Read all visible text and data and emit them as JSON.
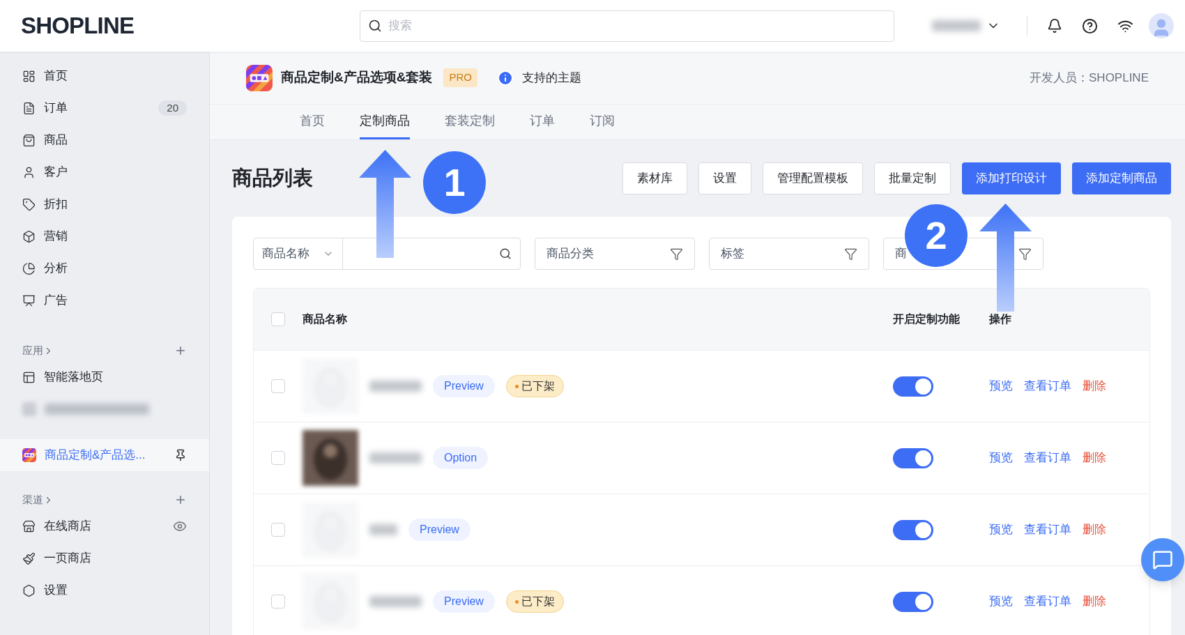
{
  "topbar": {
    "logo": "SHOPLINE",
    "search": {
      "placeholder": "搜索"
    }
  },
  "sidebar": {
    "items": [
      {
        "label": "首页",
        "selected": false
      },
      {
        "label": "订单",
        "badge": "20",
        "selected": false
      },
      {
        "label": "商品",
        "selected": false
      },
      {
        "label": "客户",
        "selected": false
      },
      {
        "label": "折扣",
        "selected": false
      },
      {
        "label": "营销",
        "selected": false
      },
      {
        "label": "分析",
        "selected": false
      },
      {
        "label": "广告",
        "selected": false
      }
    ],
    "apps": {
      "heading": "应用",
      "items": [
        {
          "label": "智能落地页",
          "selected": false,
          "pinned": false
        },
        {
          "label": "商品定制&产品选...",
          "selected": true,
          "pinned": true
        }
      ]
    },
    "channels": {
      "heading": "渠道",
      "items": [
        {
          "label": "在线商店",
          "selected": false,
          "visible": true
        },
        {
          "label": "一页商店",
          "selected": false,
          "visible": false
        }
      ]
    },
    "settings": {
      "label": "设置"
    }
  },
  "app_header": {
    "title": "商品定制&产品选项&套装",
    "badge": "PRO",
    "info_link": "支持的主题",
    "developer": "开发人员：SHOPLINE"
  },
  "tabs": [
    {
      "label": "首页",
      "selected": false
    },
    {
      "label": "定制商品",
      "selected": true
    },
    {
      "label": "套装定制",
      "selected": false
    },
    {
      "label": "订单",
      "selected": false
    },
    {
      "label": "订阅",
      "selected": false
    }
  ],
  "page": {
    "title": "商品列表",
    "buttons": [
      {
        "label": "素材库",
        "primary": false
      },
      {
        "label": "设置",
        "primary": false
      },
      {
        "label": "管理配置模板",
        "primary": false
      },
      {
        "label": "批量定制",
        "primary": false
      },
      {
        "label": "添加打印设计",
        "primary": true
      },
      {
        "label": "添加定制商品",
        "primary": true
      }
    ]
  },
  "filters": {
    "name_select": "商品名称",
    "category": "商品分类",
    "tags": "标签",
    "column_4": "商"
  },
  "table": {
    "columns": [
      "商品名称",
      "开启定制功能",
      "操作"
    ],
    "checked": false,
    "rows": [
      {
        "checked": false,
        "chip": "Preview",
        "status": "已下架",
        "on": true,
        "actions": [
          "预览",
          "查看订单",
          "删除"
        ]
      },
      {
        "checked": false,
        "chip": "Option",
        "on": true,
        "actions": [
          "预览",
          "查看订单",
          "删除"
        ]
      },
      {
        "checked": false,
        "chip": "Preview",
        "on": true,
        "actions": [
          "预览",
          "查看订单",
          "删除"
        ]
      },
      {
        "checked": false,
        "chip": "Preview",
        "status": "已下架",
        "on": true,
        "actions": [
          "预览",
          "查看订单",
          "删除"
        ]
      }
    ]
  },
  "annotations": [
    {
      "label": "1"
    },
    {
      "label": "2"
    }
  ]
}
